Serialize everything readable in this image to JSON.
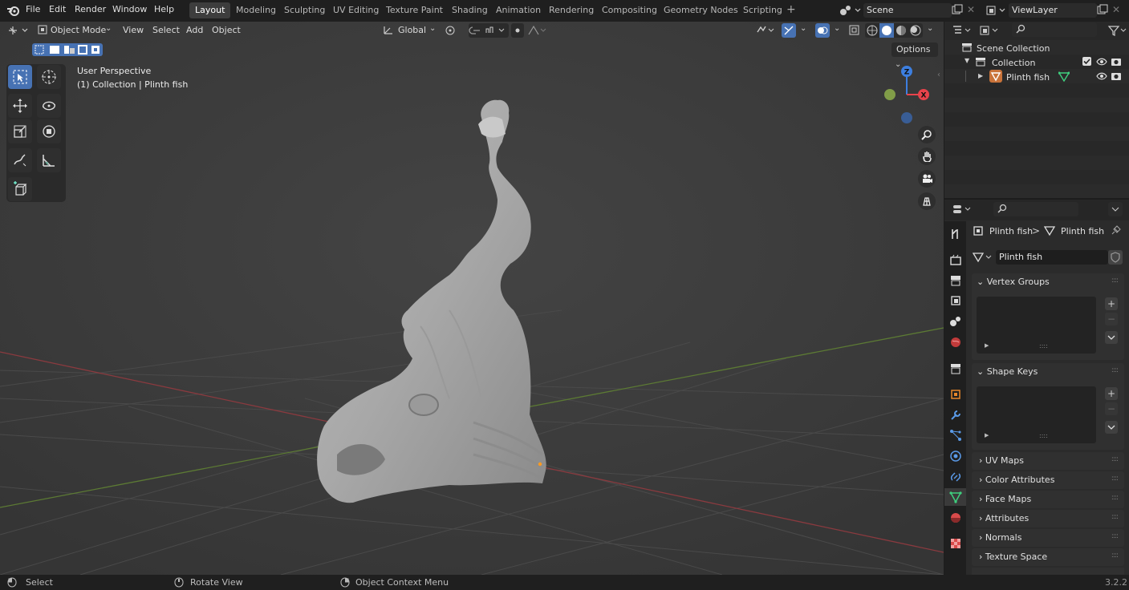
{
  "menu": [
    "File",
    "Edit",
    "Render",
    "Window",
    "Help"
  ],
  "workspaces": [
    "Layout",
    "Modeling",
    "Sculpting",
    "UV Editing",
    "Texture Paint",
    "Shading",
    "Animation",
    "Rendering",
    "Compositing",
    "Geometry Nodes",
    "Scripting"
  ],
  "active_workspace": "Layout",
  "add_workspace": "+",
  "scene_name": "Scene",
  "view_layer": "ViewLayer",
  "viewport": {
    "mode": "Object Mode",
    "menus": [
      "View",
      "Select",
      "Add",
      "Object"
    ],
    "transform_orientation": "Global",
    "options_label": "Options",
    "overlay_title": "User Perspective",
    "overlay_subtitle": "(1) Collection | Plinth fish",
    "gizmo_axes": {
      "z": "Z",
      "x": "X"
    }
  },
  "outliner": {
    "scene_collection": "Scene Collection",
    "collection": "Collection",
    "object": "Plinth fish"
  },
  "properties": {
    "breadcrumb_object": "Plinth fish",
    "breadcrumb_sep": ">",
    "breadcrumb_mesh": "Plinth fish",
    "mesh_name": "Plinth fish",
    "expanded_panels": [
      "Vertex Groups",
      "Shape Keys"
    ],
    "collapsed_panels": [
      "UV Maps",
      "Color Attributes",
      "Face Maps",
      "Attributes",
      "Normals",
      "Texture Space"
    ]
  },
  "statusbar": {
    "select": "Select",
    "rotate": "Rotate View",
    "context": "Object Context Menu",
    "version": "3.2.2"
  },
  "colors": {
    "accent": "#4772b3",
    "x_axis": "#e8434b",
    "y_axis": "#6aa63b",
    "z_axis": "#3d7fe0",
    "mesh_icon": "#3fcf7e"
  }
}
